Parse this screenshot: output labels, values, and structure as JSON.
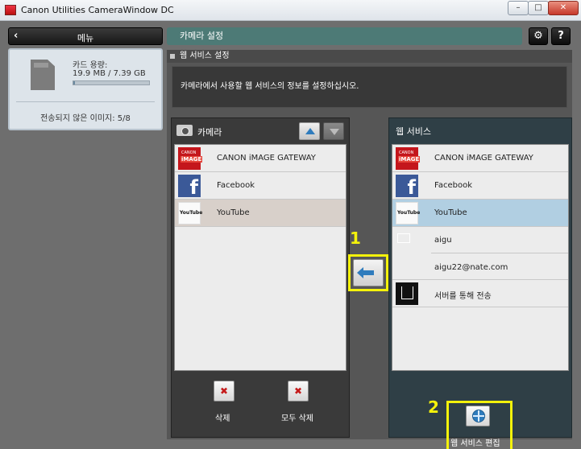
{
  "window": {
    "title": "Canon Utilities CameraWindow DC",
    "min": "–",
    "max": "□",
    "close": "✕"
  },
  "sidebar": {
    "back_label": "메뉴",
    "card_capacity_label": "카드 용량:",
    "card_capacity_value": "19.9 MB / 7.39 GB",
    "card_usage_fraction": 0.003,
    "unsent_images": "전송되지 않은 이미지: 5/8"
  },
  "header": {
    "title": "카메라 설정",
    "settings_icon": "gear-icon",
    "help_label": "?"
  },
  "web_services_settings": {
    "section_title": "웹 서비스 설정",
    "description": "카메라에서 사용할 웹 서비스의 정보를 설정하십시오."
  },
  "camera": {
    "title": "카메라",
    "items": [
      {
        "label": "CANON iMAGE GATEWAY",
        "icon": "canon-image-gateway-icon"
      },
      {
        "label": "Facebook",
        "icon": "facebook-icon"
      },
      {
        "label": "YouTube",
        "icon": "youtube-icon"
      }
    ],
    "selected_index": 2,
    "delete_label": "삭제",
    "delete_all_label": "모두 삭제"
  },
  "web_service": {
    "title": "웹 서비스",
    "items": [
      {
        "label": "CANON iMAGE GATEWAY",
        "icon": "canon-image-gateway-icon"
      },
      {
        "label": "Facebook",
        "icon": "facebook-icon"
      },
      {
        "label": "YouTube",
        "icon": "youtube-icon"
      }
    ],
    "email": {
      "name": "aigu",
      "address": "aigu22@nate.com",
      "icon": "mail-icon"
    },
    "server": {
      "label": "서버를 통해 전송",
      "icon": "download-icon"
    },
    "selected_index": 2,
    "edit_label": "웹 서비스 편집"
  },
  "callouts": {
    "one": "1",
    "two": "2"
  },
  "colors": {
    "accent": "#4d7a76",
    "highlight": "#f4f20b",
    "selection": "#b1cfe2"
  }
}
